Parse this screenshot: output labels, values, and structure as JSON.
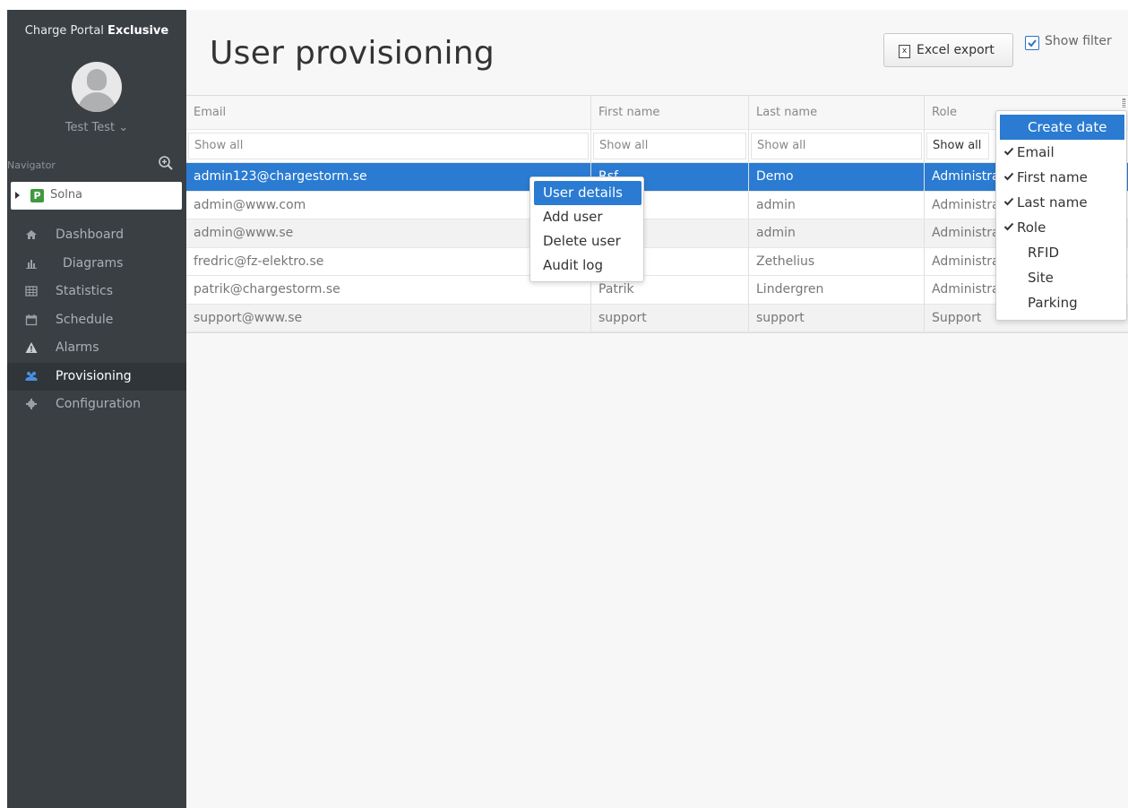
{
  "sidebar": {
    "brand_regular": "Charge Portal",
    "brand_bold": "Exclusive",
    "user_name": "Test Test ⌄",
    "navigator_label": "Navigator",
    "site_name": "Solna",
    "items": [
      {
        "label": "Dashboard",
        "icon": "home-icon"
      },
      {
        "label": "Diagrams",
        "icon": "bar-chart-icon"
      },
      {
        "label": "Statistics",
        "icon": "table-icon"
      },
      {
        "label": "Schedule",
        "icon": "calendar-icon"
      },
      {
        "label": "Alarms",
        "icon": "warning-icon"
      },
      {
        "label": "Provisioning",
        "icon": "users-icon",
        "active": true
      },
      {
        "label": "Configuration",
        "icon": "gear-icon"
      }
    ]
  },
  "header": {
    "title": "User provisioning",
    "excel_export": "Excel export",
    "show_filter": "Show filter",
    "show_filter_checked": true
  },
  "table": {
    "columns": [
      "Email",
      "First name",
      "Last name",
      "Role"
    ],
    "filter_placeholder": "Show all",
    "rows": [
      {
        "email": "admin123@chargestorm.se",
        "first": "Rsf",
        "last": "Demo",
        "role": "Administrator",
        "selected": true
      },
      {
        "email": "admin@www.com",
        "first": "",
        "last": "admin",
        "role": "Administrator"
      },
      {
        "email": "admin@www.se",
        "first": "",
        "last": "admin",
        "role": "Administrator"
      },
      {
        "email": "fredric@fz-elektro.se",
        "first": "",
        "last": "Zethelius",
        "role": "Administrator"
      },
      {
        "email": "patrik@chargestorm.se",
        "first": "Patrik",
        "last": "Lindergren",
        "role": "Administrator"
      },
      {
        "email": "support@www.se",
        "first": "support",
        "last": "support",
        "role": "Support"
      }
    ]
  },
  "context_menu": {
    "items": [
      "User details",
      "Add user",
      "Delete user",
      "Audit log"
    ],
    "highlighted": "User details"
  },
  "column_menu": {
    "items": [
      {
        "label": "Create date",
        "checked": false,
        "highlighted": true
      },
      {
        "label": "Email",
        "checked": true
      },
      {
        "label": "First name",
        "checked": true
      },
      {
        "label": "Last name",
        "checked": true
      },
      {
        "label": "Role",
        "checked": true
      },
      {
        "label": "RFID",
        "checked": false
      },
      {
        "label": "Site",
        "checked": false
      },
      {
        "label": "Parking",
        "checked": false
      }
    ]
  },
  "colors": {
    "sidebar_bg": "#3a3f44",
    "accent": "#2a7bd1",
    "site_icon": "#3f9a3f"
  }
}
